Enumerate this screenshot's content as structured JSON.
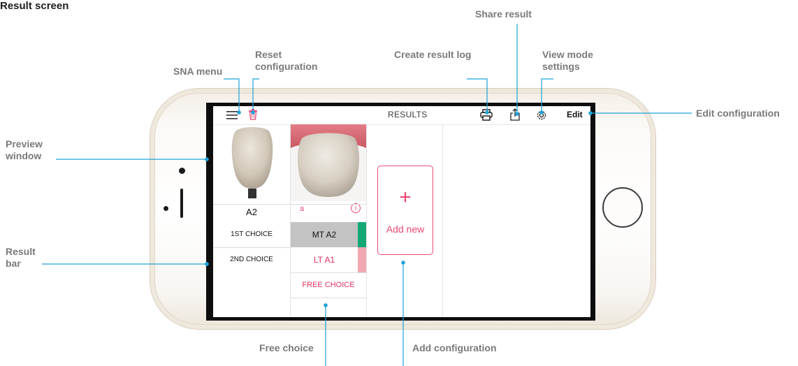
{
  "heading": "Result screen",
  "callouts": {
    "share_result": "Share result",
    "create_result_log": "Create result log",
    "view_mode_settings": [
      "View mode",
      "settings"
    ],
    "reset_configuration": [
      "Reset",
      "configuration"
    ],
    "sna_menu": "SNA menu",
    "edit_configuration": "Edit configuration",
    "preview_window": [
      "Preview",
      "window"
    ],
    "result_bar": [
      "Result",
      "bar"
    ],
    "free_choice": "Free choice",
    "add_configuration": "Add configuration"
  },
  "app": {
    "title": "RESULTS",
    "edit_label": "Edit",
    "preview": {
      "shade": "A2",
      "sample_label": "a",
      "info_symbol": "i"
    },
    "result_rows": [
      {
        "label": "1ST CHOICE",
        "value": "MT A2",
        "color": "#13a874"
      },
      {
        "label": "2ND CHOICE",
        "value": "LT A1",
        "color": "#f2a8b2"
      }
    ],
    "free_choice_label": "FREE CHOICE",
    "add_new_label": "Add new",
    "colors": {
      "accent": "#e84a72",
      "callout_line": "#1ea2d9"
    }
  },
  "icons": [
    "menu-icon",
    "trash-icon",
    "printer-icon",
    "share-icon",
    "gear-icon",
    "info-icon",
    "plus-icon"
  ]
}
